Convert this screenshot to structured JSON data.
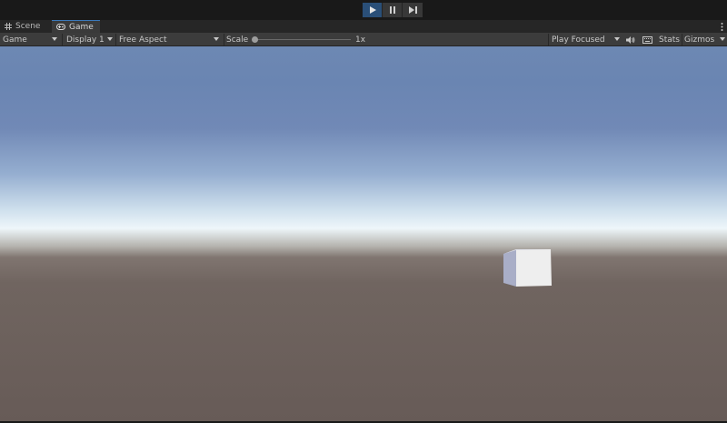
{
  "playbar": {
    "play_icon": "play-icon",
    "pause_icon": "pause-icon",
    "step_icon": "step-icon",
    "active_color": "#2a4f78"
  },
  "tabs": [
    {
      "label": "Scene",
      "icon": "grid-icon"
    },
    {
      "label": "Game",
      "icon": "gamepad-icon",
      "active": true
    }
  ],
  "toolbar": {
    "view_mode": "Game",
    "display": "Display 1",
    "aspect": "Free Aspect",
    "scale_label": "Scale",
    "scale_value": "1x",
    "scale_fraction": 0.0,
    "play_mode": "Play Focused",
    "audio_icon": "speaker-icon",
    "keyboard_icon": "keyboard-icon",
    "stats_label": "Stats",
    "gizmos_label": "Gizmos"
  },
  "scene": {
    "sky_top_color": "#6d88b3",
    "horizon_color": "#eef6fa",
    "ground_color": "#675b57",
    "object": "cube"
  }
}
